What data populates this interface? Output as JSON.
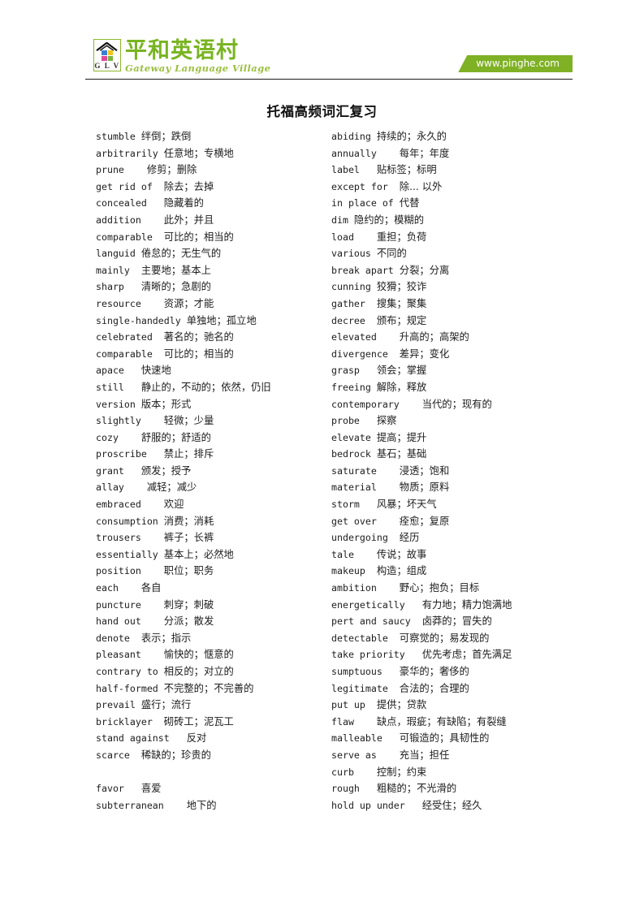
{
  "header": {
    "logo": {
      "mark_label": "G L V",
      "icon_name": "house-roof-icon",
      "brand_cn": "平和英语村",
      "brand_en": "Gateway Language Village",
      "colors": {
        "brand_green": "#78b421",
        "banner_green": "#7fb125",
        "square_blue": "#3b7fd4",
        "square_yellow": "#f2c41c",
        "square_pink": "#e0499a",
        "square_green": "#7bb63f"
      }
    },
    "url_banner": "www.pinghe.com"
  },
  "title": "托福高频词汇复习",
  "columns": {
    "left": [
      {
        "term": "stumble ",
        "gloss": "绊倒；跌倒"
      },
      {
        "term": "arbitrarily ",
        "gloss": "任意地；专横地"
      },
      {
        "term": "prune    ",
        "gloss": "修剪；删除"
      },
      {
        "term": "get rid of  ",
        "gloss": "除去；去掉"
      },
      {
        "term": "concealed   ",
        "gloss": "隐藏着的"
      },
      {
        "term": "addition    ",
        "gloss": "此外；并且"
      },
      {
        "term": "comparable  ",
        "gloss": "可比的；相当的"
      },
      {
        "term": "languid ",
        "gloss": "倦怠的；无生气的"
      },
      {
        "term": "mainly  ",
        "gloss": "主要地；基本上"
      },
      {
        "term": "sharp   ",
        "gloss": "清晰的；急剧的"
      },
      {
        "term": "resource    ",
        "gloss": "资源；才能"
      },
      {
        "term": "single-handedly ",
        "gloss": "单独地；孤立地"
      },
      {
        "term": "celebrated  ",
        "gloss": "著名的；驰名的"
      },
      {
        "term": "comparable  ",
        "gloss": "可比的；相当的"
      },
      {
        "term": "apace   ",
        "gloss": "快速地"
      },
      {
        "term": "still   ",
        "gloss": "静止的，不动的；依然，仍旧"
      },
      {
        "term": "version ",
        "gloss": "版本；形式"
      },
      {
        "term": "slightly    ",
        "gloss": "轻微；少量"
      },
      {
        "term": "cozy    ",
        "gloss": "舒服的；舒适的"
      },
      {
        "term": "proscribe   ",
        "gloss": "禁止；排斥"
      },
      {
        "term": "grant   ",
        "gloss": "颁发；授予"
      },
      {
        "term": "allay    ",
        "gloss": "减轻；减少"
      },
      {
        "term": "embraced    ",
        "gloss": "欢迎"
      },
      {
        "term": "consumption ",
        "gloss": "消费；消耗"
      },
      {
        "term": "trousers    ",
        "gloss": "裤子；长裤"
      },
      {
        "term": "essentially ",
        "gloss": "基本上；必然地"
      },
      {
        "term": "position    ",
        "gloss": "职位；职务"
      },
      {
        "term": "each    ",
        "gloss": "各自"
      },
      {
        "term": "puncture    ",
        "gloss": "刺穿；刺破"
      },
      {
        "term": "hand out    ",
        "gloss": "分派；散发"
      },
      {
        "term": "denote  ",
        "gloss": "表示；指示"
      },
      {
        "term": "pleasant    ",
        "gloss": "愉快的；惬意的"
      },
      {
        "term": "contrary to ",
        "gloss": "相反的；对立的"
      },
      {
        "term": "half-formed ",
        "gloss": "不完整的；不完善的"
      },
      {
        "term": "prevail ",
        "gloss": "盛行；流行"
      },
      {
        "term": "bricklayer  ",
        "gloss": "砌砖工；泥瓦工"
      },
      {
        "term": "stand against   ",
        "gloss": "反对"
      },
      {
        "term": "scarce  ",
        "gloss": "稀缺的；珍贵的"
      },
      {
        "term": "",
        "gloss": ""
      },
      {
        "term": "favor   ",
        "gloss": "喜爱"
      },
      {
        "term": "subterranean    ",
        "gloss": "地下的"
      }
    ],
    "right": [
      {
        "term": "abiding ",
        "gloss": "持续的；永久的"
      },
      {
        "term": "annually    ",
        "gloss": "每年；年度"
      },
      {
        "term": "label   ",
        "gloss": "贴标签；标明"
      },
      {
        "term": "except for  ",
        "gloss": "除... 以外"
      },
      {
        "term": "in place of ",
        "gloss": "代替"
      },
      {
        "term": "dim ",
        "gloss": "隐约的；模糊的"
      },
      {
        "term": "load    ",
        "gloss": "重担；负荷"
      },
      {
        "term": "various ",
        "gloss": "不同的"
      },
      {
        "term": "break apart ",
        "gloss": "分裂；分离"
      },
      {
        "term": "cunning ",
        "gloss": "狡猾；狡诈"
      },
      {
        "term": "gather  ",
        "gloss": "搜集；聚集"
      },
      {
        "term": "decree  ",
        "gloss": "颁布；规定"
      },
      {
        "term": "elevated    ",
        "gloss": "升高的；高架的"
      },
      {
        "term": "divergence  ",
        "gloss": "差异；变化"
      },
      {
        "term": "grasp   ",
        "gloss": "领会；掌握"
      },
      {
        "term": "freeing ",
        "gloss": "解除，释放"
      },
      {
        "term": "contemporary    ",
        "gloss": "当代的；现有的"
      },
      {
        "term": "probe   ",
        "gloss": "探察"
      },
      {
        "term": "elevate ",
        "gloss": "提高；提升"
      },
      {
        "term": "bedrock ",
        "gloss": "基石；基础"
      },
      {
        "term": "saturate    ",
        "gloss": "浸透；饱和"
      },
      {
        "term": "material    ",
        "gloss": "物质；原料"
      },
      {
        "term": "storm   ",
        "gloss": "风暴；坏天气"
      },
      {
        "term": "get over    ",
        "gloss": "痊愈；复原"
      },
      {
        "term": "undergoing  ",
        "gloss": "经历"
      },
      {
        "term": "tale    ",
        "gloss": "传说；故事"
      },
      {
        "term": "makeup  ",
        "gloss": "构造；组成"
      },
      {
        "term": "ambition    ",
        "gloss": "野心；抱负；目标"
      },
      {
        "term": "energetically   ",
        "gloss": "有力地；精力饱满地"
      },
      {
        "term": "pert and saucy  ",
        "gloss": "卤莽的；冒失的"
      },
      {
        "term": "detectable  ",
        "gloss": "可察觉的；易发现的"
      },
      {
        "term": "take priority   ",
        "gloss": "优先考虑；首先满足"
      },
      {
        "term": "sumptuous   ",
        "gloss": "豪华的；奢侈的"
      },
      {
        "term": "legitimate  ",
        "gloss": "合法的；合理的"
      },
      {
        "term": "put up  ",
        "gloss": "提供；贷款"
      },
      {
        "term": "flaw    ",
        "gloss": "缺点，瑕疵；有缺陷；有裂缝"
      },
      {
        "term": "malleable   ",
        "gloss": "可锻造的；具韧性的"
      },
      {
        "term": "serve as    ",
        "gloss": "充当；担任"
      },
      {
        "term": "curb    ",
        "gloss": "控制；约束"
      },
      {
        "term": "rough   ",
        "gloss": "粗糙的；不光滑的"
      },
      {
        "term": "hold up under   ",
        "gloss": "经受住；经久"
      }
    ]
  }
}
